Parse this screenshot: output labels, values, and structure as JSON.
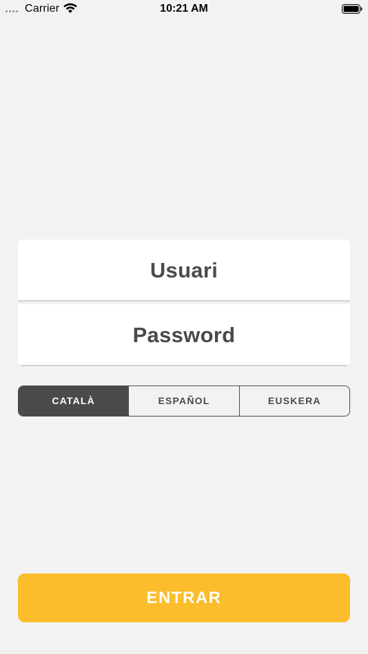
{
  "status_bar": {
    "carrier": "Carrier",
    "time": "10:21 AM",
    "icons": [
      "signal-dots-icon",
      "wifi-icon",
      "battery-icon"
    ]
  },
  "login": {
    "username_placeholder": "Usuari",
    "password_placeholder": "Password"
  },
  "languages": {
    "options": [
      "CATALÀ",
      "ESPAÑOL",
      "EUSKERA"
    ],
    "selected": "CATALÀ"
  },
  "enter_button": {
    "label": "ENTRAR"
  },
  "colors": {
    "background": "#f2f2f2",
    "accent": "#fbbd2b",
    "dark": "#4a4a4a",
    "card": "#ffffff"
  }
}
